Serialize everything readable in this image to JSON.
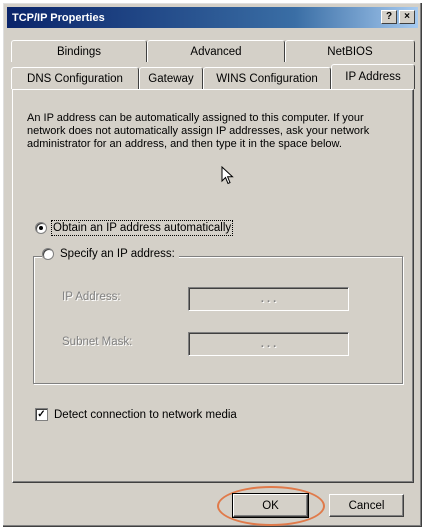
{
  "window": {
    "title": "TCP/IP Properties",
    "help_glyph": "?",
    "close_glyph": "×"
  },
  "tabs": {
    "back_row": [
      "Bindings",
      "Advanced",
      "NetBIOS"
    ],
    "front_row": [
      "DNS Configuration",
      "Gateway",
      "WINS Configuration",
      "IP Address"
    ],
    "active": "IP Address"
  },
  "description": "An IP address can be automatically assigned to this computer. If your network does not automatically assign IP addresses, ask your network administrator for an address, and then type it in the space below.",
  "options": {
    "obtain_auto": {
      "label": "Obtain an IP address automatically",
      "mnemonic": "O",
      "selected": true
    },
    "specify": {
      "label": "Specify an IP address:",
      "mnemonic": "S",
      "selected": false
    }
  },
  "fields": {
    "ip_address": {
      "label": "IP Address:",
      "value": ". . ."
    },
    "subnet_mask": {
      "label": "Subnet Mask:",
      "value": ". . ."
    }
  },
  "detect_media": {
    "label": "Detect connection to network media",
    "mnemonic": "D",
    "checked": true,
    "check_glyph": "✓"
  },
  "buttons": {
    "ok": "OK",
    "cancel": "Cancel"
  },
  "colors": {
    "face": "#d4d0c8",
    "title_start": "#0a246a",
    "highlight_ring": "#e07a4a"
  },
  "icons": [
    "help-icon",
    "close-icon",
    "mouse-cursor-icon",
    "checkmark-icon"
  ]
}
